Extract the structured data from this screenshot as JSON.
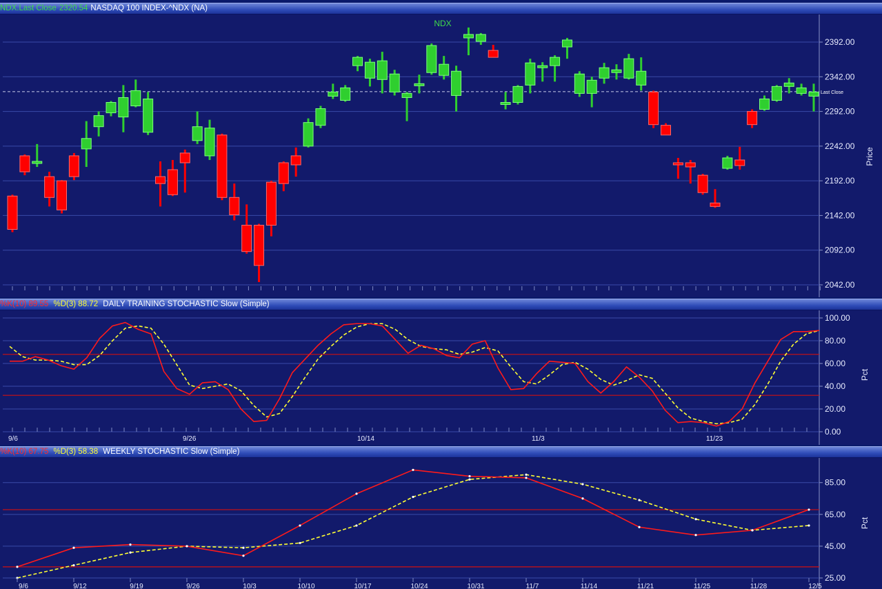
{
  "header_main": {
    "symbol_label": "NDX.Last Close",
    "last_close": "2320.54",
    "title": "NASDAQ 100 INDEX-^NDX (NA)"
  },
  "header_daily": {
    "k_label": "%K(10) 89.55",
    "d_label": "%D(3) 88.72",
    "title": "DAILY TRAINING STOCHASTIC Slow (Simple)"
  },
  "header_weekly": {
    "k_label": "%K(10) 67.75",
    "d_label": "%D(3) 58.38",
    "title": "WEEKLY STOCHASTIC Slow (Simple)"
  },
  "colors": {
    "up": "#2fcf2f",
    "down": "#ff0000",
    "k_line": "#ff1a1a",
    "d_line": "#ffff33",
    "bg": "#121a6b",
    "band": "#d01010"
  },
  "chart_data": [
    {
      "type": "candlestick",
      "title": "NDX",
      "ylabel": "Price",
      "ylim": [
        2042,
        2410
      ],
      "yticks": [
        "2392.00",
        "2342.00",
        "2292.00",
        "2242.00",
        "2192.00",
        "2142.00",
        "2092.00",
        "2042.00"
      ],
      "last_close": 2320.54,
      "last_close_label": "Last Close",
      "candles": [
        {
          "o": 2170,
          "h": 2172,
          "l": 2118,
          "c": 2122
        },
        {
          "o": 2228,
          "h": 2230,
          "l": 2200,
          "c": 2205
        },
        {
          "o": 2218,
          "h": 2245,
          "l": 2212,
          "c": 2220
        },
        {
          "o": 2198,
          "h": 2205,
          "l": 2155,
          "c": 2168
        },
        {
          "o": 2192,
          "h": 2193,
          "l": 2145,
          "c": 2150
        },
        {
          "o": 2228,
          "h": 2232,
          "l": 2193,
          "c": 2198
        },
        {
          "o": 2238,
          "h": 2278,
          "l": 2212,
          "c": 2253
        },
        {
          "o": 2270,
          "h": 2292,
          "l": 2256,
          "c": 2286
        },
        {
          "o": 2290,
          "h": 2307,
          "l": 2285,
          "c": 2305
        },
        {
          "o": 2284,
          "h": 2330,
          "l": 2262,
          "c": 2312
        },
        {
          "o": 2300,
          "h": 2338,
          "l": 2298,
          "c": 2322
        },
        {
          "o": 2262,
          "h": 2320,
          "l": 2258,
          "c": 2310
        },
        {
          "o": 2198,
          "h": 2220,
          "l": 2155,
          "c": 2188
        },
        {
          "o": 2208,
          "h": 2222,
          "l": 2170,
          "c": 2172
        },
        {
          "o": 2232,
          "h": 2237,
          "l": 2175,
          "c": 2218
        },
        {
          "o": 2250,
          "h": 2292,
          "l": 2245,
          "c": 2270
        },
        {
          "o": 2228,
          "h": 2280,
          "l": 2222,
          "c": 2268
        },
        {
          "o": 2258,
          "h": 2260,
          "l": 2164,
          "c": 2168
        },
        {
          "o": 2168,
          "h": 2188,
          "l": 2135,
          "c": 2143
        },
        {
          "o": 2128,
          "h": 2158,
          "l": 2087,
          "c": 2090
        },
        {
          "o": 2128,
          "h": 2130,
          "l": 2046,
          "c": 2070
        },
        {
          "o": 2190,
          "h": 2192,
          "l": 2112,
          "c": 2128
        },
        {
          "o": 2218,
          "h": 2220,
          "l": 2177,
          "c": 2188
        },
        {
          "o": 2228,
          "h": 2240,
          "l": 2198,
          "c": 2215
        },
        {
          "o": 2242,
          "h": 2282,
          "l": 2240,
          "c": 2276
        },
        {
          "o": 2272,
          "h": 2300,
          "l": 2268,
          "c": 2296
        },
        {
          "o": 2314,
          "h": 2332,
          "l": 2310,
          "c": 2320
        },
        {
          "o": 2308,
          "h": 2330,
          "l": 2306,
          "c": 2326
        },
        {
          "o": 2358,
          "h": 2372,
          "l": 2350,
          "c": 2370
        },
        {
          "o": 2340,
          "h": 2368,
          "l": 2328,
          "c": 2363
        },
        {
          "o": 2338,
          "h": 2378,
          "l": 2318,
          "c": 2365
        },
        {
          "o": 2320,
          "h": 2352,
          "l": 2315,
          "c": 2346
        },
        {
          "o": 2312,
          "h": 2320,
          "l": 2278,
          "c": 2318
        },
        {
          "o": 2330,
          "h": 2345,
          "l": 2318,
          "c": 2332
        },
        {
          "o": 2348,
          "h": 2390,
          "l": 2345,
          "c": 2387
        },
        {
          "o": 2344,
          "h": 2372,
          "l": 2338,
          "c": 2360
        },
        {
          "o": 2315,
          "h": 2358,
          "l": 2292,
          "c": 2350
        },
        {
          "o": 2398,
          "h": 2413,
          "l": 2373,
          "c": 2403
        },
        {
          "o": 2393,
          "h": 2405,
          "l": 2388,
          "c": 2403
        },
        {
          "o": 2380,
          "h": 2388,
          "l": 2375,
          "c": 2370
        },
        {
          "o": 2302,
          "h": 2320,
          "l": 2295,
          "c": 2305
        },
        {
          "o": 2305,
          "h": 2330,
          "l": 2302,
          "c": 2328
        },
        {
          "o": 2330,
          "h": 2368,
          "l": 2318,
          "c": 2362
        },
        {
          "o": 2358,
          "h": 2363,
          "l": 2335,
          "c": 2358
        },
        {
          "o": 2358,
          "h": 2373,
          "l": 2335,
          "c": 2370
        },
        {
          "o": 2385,
          "h": 2398,
          "l": 2368,
          "c": 2395
        },
        {
          "o": 2318,
          "h": 2350,
          "l": 2313,
          "c": 2346
        },
        {
          "o": 2318,
          "h": 2342,
          "l": 2298,
          "c": 2337
        },
        {
          "o": 2340,
          "h": 2362,
          "l": 2332,
          "c": 2355
        },
        {
          "o": 2348,
          "h": 2360,
          "l": 2338,
          "c": 2352
        },
        {
          "o": 2340,
          "h": 2375,
          "l": 2338,
          "c": 2368
        },
        {
          "o": 2330,
          "h": 2370,
          "l": 2322,
          "c": 2350
        },
        {
          "o": 2320,
          "h": 2322,
          "l": 2268,
          "c": 2273
        },
        {
          "o": 2272,
          "h": 2275,
          "l": 2258,
          "c": 2258
        },
        {
          "o": 2218,
          "h": 2225,
          "l": 2195,
          "c": 2215
        },
        {
          "o": 2218,
          "h": 2222,
          "l": 2188,
          "c": 2212
        },
        {
          "o": 2200,
          "h": 2202,
          "l": 2172,
          "c": 2175
        },
        {
          "o": 2160,
          "h": 2180,
          "l": 2153,
          "c": 2155
        },
        {
          "o": 2210,
          "h": 2228,
          "l": 2208,
          "c": 2225
        },
        {
          "o": 2222,
          "h": 2241,
          "l": 2208,
          "c": 2214
        },
        {
          "o": 2292,
          "h": 2295,
          "l": 2268,
          "c": 2273
        },
        {
          "o": 2295,
          "h": 2315,
          "l": 2293,
          "c": 2310
        },
        {
          "o": 2308,
          "h": 2330,
          "l": 2306,
          "c": 2328
        },
        {
          "o": 2328,
          "h": 2340,
          "l": 2318,
          "c": 2333
        },
        {
          "o": 2318,
          "h": 2332,
          "l": 2315,
          "c": 2326
        },
        {
          "o": 2314,
          "h": 2332,
          "l": 2292,
          "c": 2320
        }
      ]
    },
    {
      "type": "line",
      "title": "DAILY TRAINING STOCHASTIC Slow (Simple)",
      "ylabel": "Pct",
      "ylim": [
        0,
        100
      ],
      "yticks": [
        "100.00",
        "80.00",
        "60.00",
        "40.00",
        "20.00",
        "0.00"
      ],
      "bands": [
        32,
        68
      ],
      "xlabels": [
        {
          "i": 0,
          "label": "9/6"
        },
        {
          "i": 14,
          "label": "9/26"
        },
        {
          "i": 28,
          "label": "10/14"
        },
        {
          "i": 42,
          "label": "11/3"
        },
        {
          "i": 56,
          "label": "11/23"
        }
      ],
      "series": [
        {
          "name": "%K(10)",
          "values": [
            62,
            62,
            66,
            63,
            58,
            55,
            65,
            82,
            93,
            96,
            90,
            86,
            53,
            38,
            33,
            43,
            44,
            37,
            20,
            9,
            10,
            29,
            52,
            64,
            76,
            86,
            94,
            95,
            95,
            93,
            81,
            69,
            76,
            73,
            67,
            65,
            77,
            80,
            56,
            37,
            38,
            51,
            62,
            61,
            60,
            44,
            34,
            44,
            57,
            48,
            36,
            19,
            8,
            9,
            8,
            5,
            9,
            20,
            43,
            62,
            81,
            88,
            88,
            89
          ],
          "note": ""
        },
        {
          "name": "%D(3)",
          "values": [
            75,
            66,
            63,
            63,
            62,
            59,
            59,
            67,
            80,
            91,
            93,
            91,
            77,
            59,
            41,
            38,
            40,
            42,
            36,
            23,
            13,
            16,
            31,
            48,
            64,
            75,
            85,
            92,
            95,
            95,
            90,
            81,
            75,
            73,
            72,
            68,
            70,
            74,
            71,
            57,
            44,
            42,
            50,
            59,
            61,
            55,
            46,
            41,
            45,
            50,
            47,
            34,
            21,
            12,
            9,
            7,
            8,
            11,
            24,
            42,
            62,
            77,
            86,
            89
          ]
        }
      ]
    },
    {
      "type": "line",
      "title": "WEEKLY STOCHASTIC Slow (Simple)",
      "ylabel": "Pct",
      "ylim": [
        25,
        94
      ],
      "yticks": [
        "85.00",
        "65.00",
        "45.00",
        "25.00"
      ],
      "bands": [
        32,
        68
      ],
      "categories": [
        "9/6",
        "9/12",
        "9/19",
        "9/26",
        "10/3",
        "10/10",
        "10/17",
        "10/24",
        "10/31",
        "11/7",
        "11/14",
        "11/21",
        "11/25",
        "11/28",
        "12/5"
      ],
      "series": [
        {
          "name": "%K(10)",
          "values": [
            32,
            44,
            46,
            45,
            39,
            58,
            78,
            93,
            89,
            88,
            75,
            57,
            52,
            55,
            68
          ]
        },
        {
          "name": "%D(3)",
          "values": [
            25,
            33,
            41,
            45,
            44,
            47,
            58,
            76,
            87,
            90,
            84,
            74,
            62,
            55,
            58
          ]
        }
      ]
    }
  ]
}
